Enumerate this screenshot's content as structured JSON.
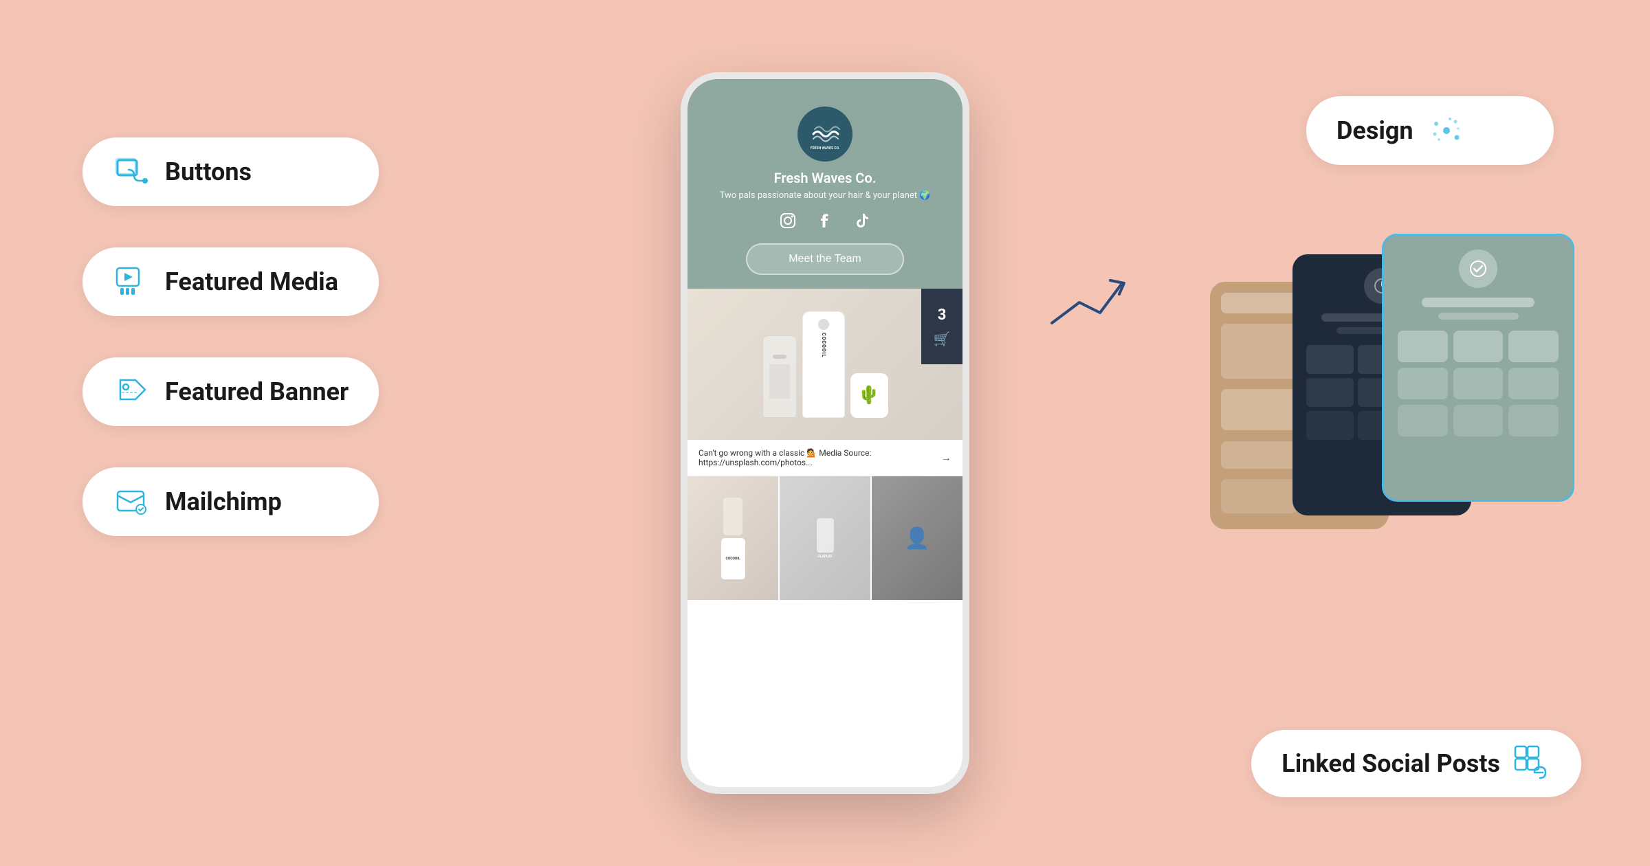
{
  "background_color": "#f4c5b5",
  "feature_pills": [
    {
      "id": "buttons",
      "label": "Buttons",
      "icon": "link-icon"
    },
    {
      "id": "featured-media",
      "label": "Featured Media",
      "icon": "play-icon"
    },
    {
      "id": "featured-banner",
      "label": "Featured Banner",
      "icon": "tag-icon"
    },
    {
      "id": "mailchimp",
      "label": "Mailchimp",
      "icon": "mail-icon"
    }
  ],
  "phone": {
    "brand_name": "Fresh Waves Co.",
    "tagline": "Two pals passionate about your hair & your planet 🌍",
    "meet_team_btn": "Meet the Team",
    "cart_count": "3",
    "caption": "Can't go wrong with a classic 💁 Media Source: https://unsplash.com/photos..."
  },
  "right_side": {
    "design_label": "Design",
    "linked_social_label": "Linked Social Posts"
  }
}
